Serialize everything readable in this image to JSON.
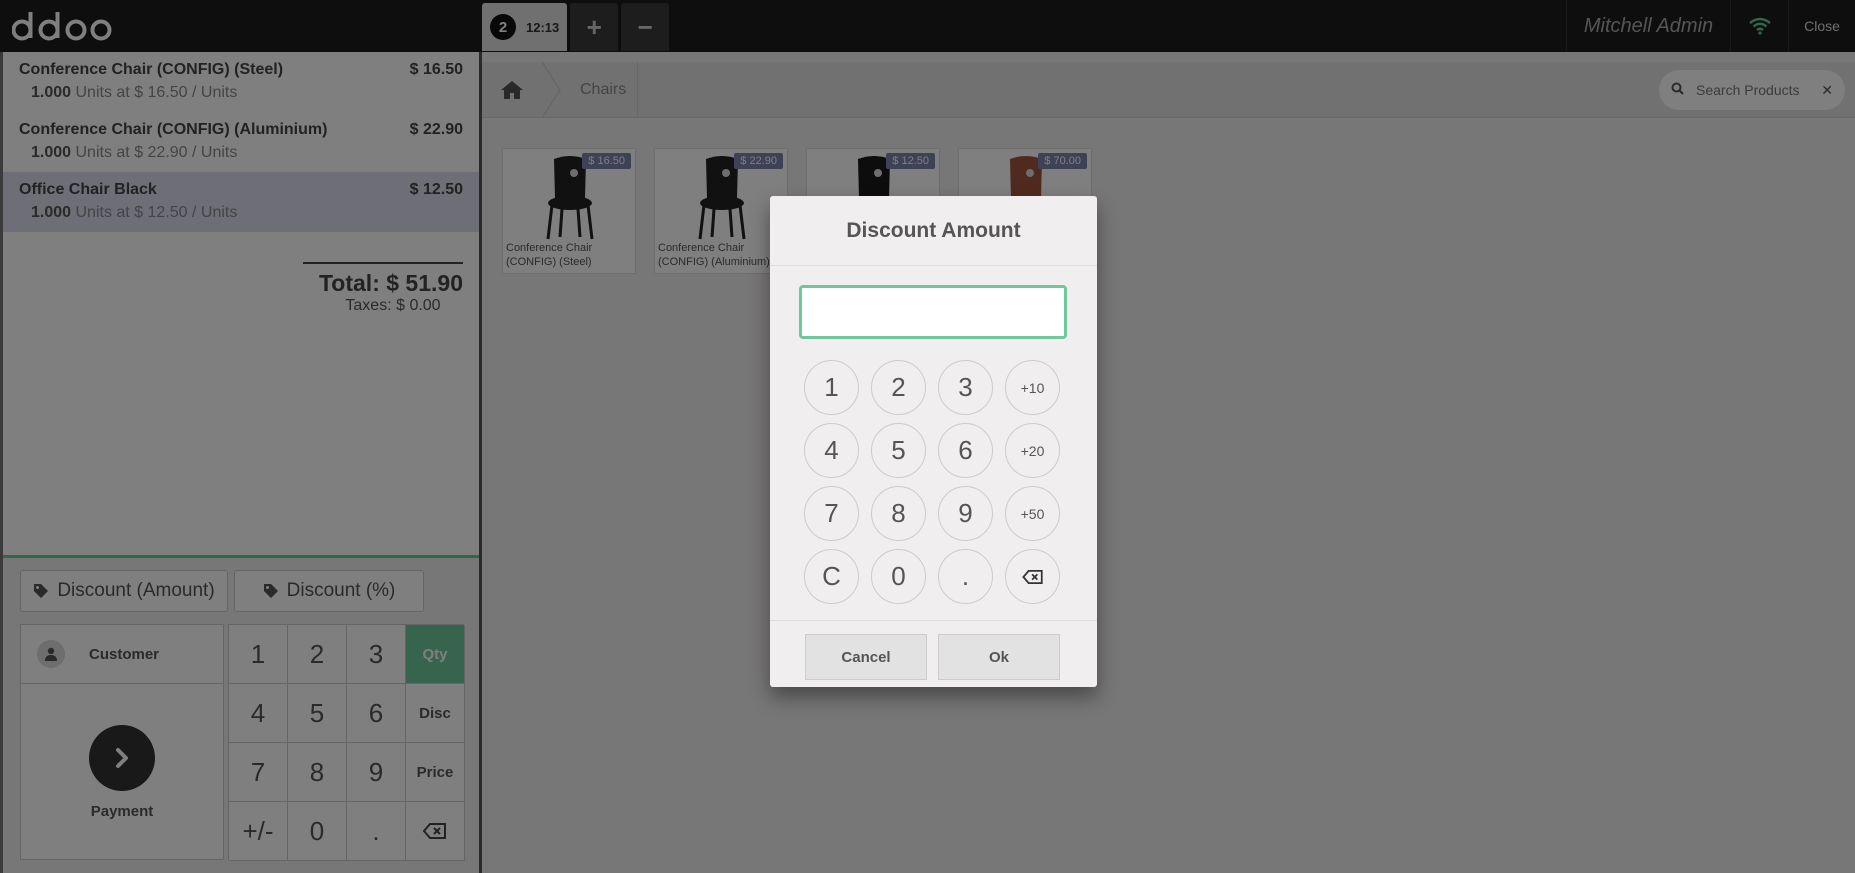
{
  "header": {
    "logo_text": "odoo",
    "order_tab": {
      "number": "2",
      "time": "12:13"
    },
    "add_order_label": "+",
    "remove_order_label": "−",
    "user_name": "Mitchell Admin",
    "close_label": "Close"
  },
  "orderlines": [
    {
      "name": "Conference Chair (CONFIG) (Steel)",
      "price": "$ 16.50",
      "qty": "1.000",
      "info": "Units at $ 16.50 / Units"
    },
    {
      "name": "Conference Chair (CONFIG) (Aluminium)",
      "price": "$ 22.90",
      "qty": "1.000",
      "info": "Units at $ 22.90 / Units"
    },
    {
      "name": "Office Chair Black",
      "price": "$ 12.50",
      "qty": "1.000",
      "info": "Units at $ 12.50 / Units"
    }
  ],
  "summary": {
    "total": "Total: $ 51.90",
    "taxes": "Taxes: $ 0.00"
  },
  "control_buttons": {
    "discount_amount": "Discount (Amount)",
    "discount_percent": "Discount (%)"
  },
  "actionpad": {
    "customer": "Customer",
    "payment": "Payment"
  },
  "numpad": {
    "keys": [
      "1",
      "2",
      "3",
      "Qty",
      "4",
      "5",
      "6",
      "Disc",
      "7",
      "8",
      "9",
      "Price",
      "+/-",
      "0",
      "."
    ],
    "active_mode": "Qty"
  },
  "breadcrumb": {
    "category": "Chairs"
  },
  "search": {
    "placeholder": "Search Products"
  },
  "products": [
    {
      "price": "$ 16.50",
      "name": "Conference Chair (CONFIG) (Steel)"
    },
    {
      "price": "$ 22.90",
      "name": "Conference Chair (CONFIG) (Aluminium)"
    },
    {
      "price": "$ 12.50",
      "name": ""
    },
    {
      "price": "$ 70.00",
      "name": ""
    }
  ],
  "dialog": {
    "title": "Discount Amount",
    "input_value": "",
    "keys": [
      "1",
      "2",
      "3",
      "+10",
      "4",
      "5",
      "6",
      "+20",
      "7",
      "8",
      "9",
      "+50",
      "C",
      "0",
      "."
    ],
    "cancel_label": "Cancel",
    "ok_label": "Ok"
  },
  "colors": {
    "accent": "#6ec89b",
    "header_bg": "#1d1d1d",
    "price_tag": "#7f82ac",
    "selected_line": "#dcdcee"
  }
}
